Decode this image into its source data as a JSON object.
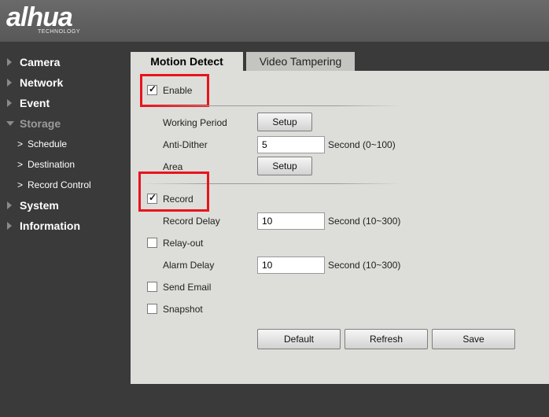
{
  "brand": {
    "logo_text": "alhua",
    "logo_subtext": "TECHNOLOGY"
  },
  "sidebar": {
    "items": [
      {
        "label": "Camera"
      },
      {
        "label": "Network"
      },
      {
        "label": "Event"
      },
      {
        "label": "Storage"
      },
      {
        "label": "System"
      },
      {
        "label": "Information"
      }
    ],
    "storage_subitems": [
      {
        "label": "Schedule"
      },
      {
        "label": "Destination"
      },
      {
        "label": "Record Control"
      }
    ]
  },
  "tabs": [
    {
      "label": "Motion Detect",
      "active": true
    },
    {
      "label": "Video Tampering",
      "active": false
    }
  ],
  "form": {
    "enable": {
      "label": "Enable",
      "checked": true
    },
    "working_period": {
      "label": "Working Period",
      "button": "Setup"
    },
    "anti_dither": {
      "label": "Anti-Dither",
      "value": "5",
      "unit": "Second (0~100)"
    },
    "area": {
      "label": "Area",
      "button": "Setup"
    },
    "record": {
      "label": "Record",
      "checked": true
    },
    "record_delay": {
      "label": "Record Delay",
      "value": "10",
      "unit": "Second (10~300)"
    },
    "relay_out": {
      "label": "Relay-out",
      "checked": false
    },
    "alarm_delay": {
      "label": "Alarm Delay",
      "value": "10",
      "unit": "Second (10~300)"
    },
    "send_email": {
      "label": "Send Email",
      "checked": false
    },
    "snapshot": {
      "label": "Snapshot",
      "checked": false
    }
  },
  "actions": {
    "default": "Default",
    "refresh": "Refresh",
    "save": "Save"
  },
  "colors": {
    "highlight": "#e8141c",
    "panel_bg": "#ddddd9",
    "sidebar_bg": "#3a3a3a",
    "header_bg": "#5e5e5e"
  }
}
